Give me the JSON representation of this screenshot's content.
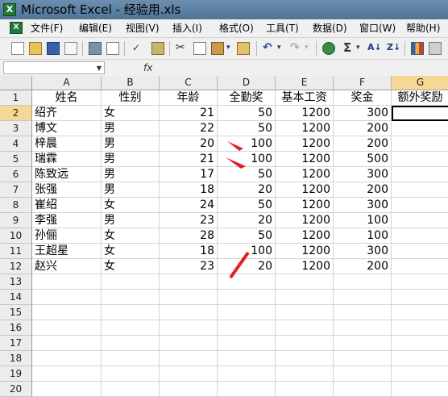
{
  "window": {
    "title": "Microsoft Excel - 经验用.xls"
  },
  "menu": [
    {
      "label": "文件(F)"
    },
    {
      "label": "编辑(E)"
    },
    {
      "label": "视图(V)"
    },
    {
      "label": "插入(I)"
    },
    {
      "label": "格式(O)"
    },
    {
      "label": "工具(T)"
    },
    {
      "label": "数据(D)"
    },
    {
      "label": "窗口(W)"
    },
    {
      "label": "帮助(H)"
    }
  ],
  "toolbar": {
    "buttons": [
      "new-icon",
      "open-icon",
      "save-icon",
      "permission-icon",
      "print-icon",
      "print-preview-icon",
      "spelling-icon",
      "research-icon",
      "cut-icon",
      "copy-icon",
      "paste-icon",
      "format-painter-icon",
      "undo-icon",
      "redo-icon",
      "hyperlink-icon",
      "autosum-icon",
      "sort-asc-icon",
      "sort-desc-icon",
      "chart-wizard-icon",
      "drawing-icon"
    ]
  },
  "formula_bar": {
    "name_box": "",
    "fx_label": "fx",
    "content": ""
  },
  "columns": [
    "A",
    "B",
    "C",
    "D",
    "E",
    "F",
    "G"
  ],
  "rows": [
    "1",
    "2",
    "3",
    "4",
    "5",
    "6",
    "7",
    "8",
    "9",
    "10",
    "11",
    "12",
    "13",
    "14",
    "15",
    "16",
    "17",
    "18",
    "19",
    "20"
  ],
  "headers": [
    "姓名",
    "性别",
    "年龄",
    "全勤奖",
    "基本工资",
    "奖金",
    "额外奖励"
  ],
  "data": [
    [
      "绍齐",
      "女",
      "21",
      "50",
      "1200",
      "300"
    ],
    [
      "博文",
      "男",
      "22",
      "50",
      "1200",
      "200"
    ],
    [
      "梓晨",
      "男",
      "20",
      "100",
      "1200",
      "200"
    ],
    [
      "瑞霖",
      "男",
      "21",
      "100",
      "1200",
      "500"
    ],
    [
      "陈致远",
      "男",
      "17",
      "50",
      "1200",
      "300"
    ],
    [
      "张强",
      "男",
      "18",
      "20",
      "1200",
      "200"
    ],
    [
      "崔绍",
      "女",
      "24",
      "50",
      "1200",
      "300"
    ],
    [
      "李强",
      "男",
      "23",
      "20",
      "1200",
      "100"
    ],
    [
      "孙俪",
      "女",
      "28",
      "50",
      "1200",
      "100"
    ],
    [
      "王超星",
      "女",
      "18",
      "100",
      "1200",
      "300"
    ],
    [
      "赵兴",
      "女",
      "23",
      "20",
      "1200",
      "200"
    ]
  ],
  "active_cell": "G2",
  "colors": {
    "annotation_arrow": "#e02020",
    "selection_header": "#f7d794"
  }
}
